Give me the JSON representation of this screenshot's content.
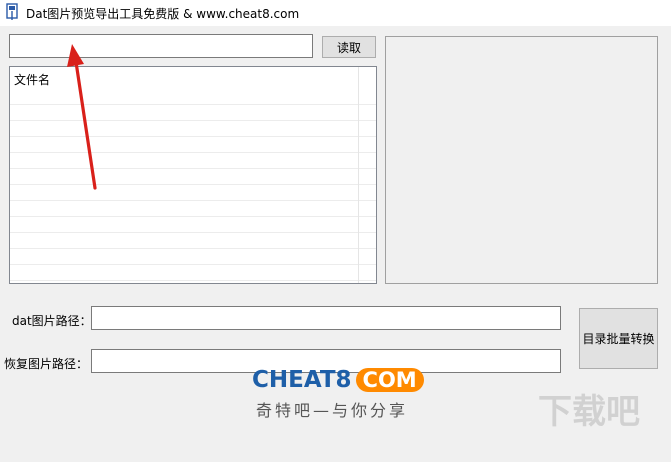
{
  "window": {
    "title": "Dat图片预览导出工具免费版 & www.cheat8.com"
  },
  "top": {
    "path_value": "",
    "read_button": "读取"
  },
  "list": {
    "column_header": "文件名"
  },
  "form": {
    "dat_label": "dat图片路径：",
    "dat_value": "",
    "restore_label": "恢复图片路径：",
    "restore_value": "",
    "convert_button": "目录批量转换"
  },
  "logo": {
    "main": "CHEAT8",
    "badge": "COM",
    "slogan": "奇特吧—与你分享"
  },
  "watermark": {
    "text": "下载吧",
    "url": ""
  },
  "colors": {
    "logo_blue": "#1e5fa8",
    "logo_orange": "#ff8a00",
    "arrow_red": "#d9201a"
  }
}
